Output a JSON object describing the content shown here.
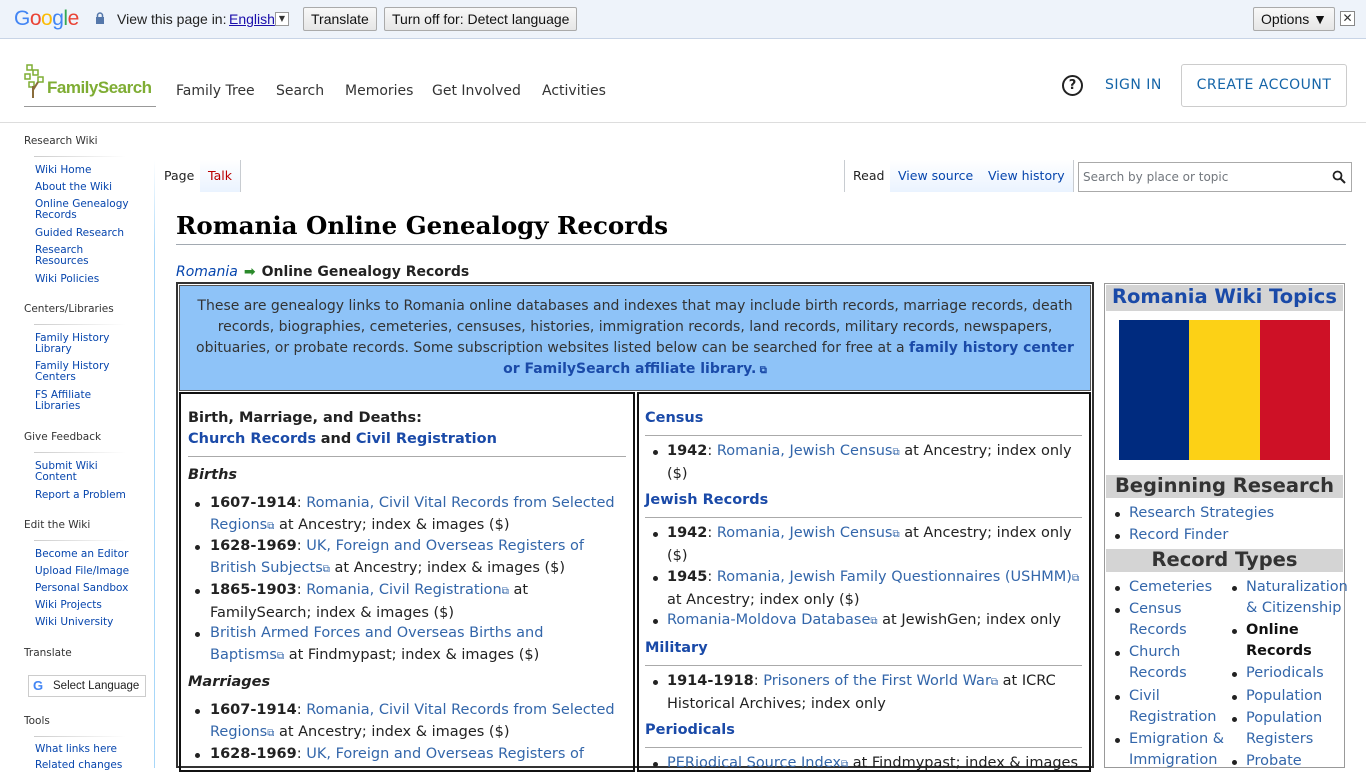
{
  "translate_bar": {
    "logo": "Google",
    "view_in": "View this page in:",
    "language": "English",
    "translate_btn": "Translate",
    "turn_off_btn": "Turn off for: Detect language",
    "options_btn": "Options ▼"
  },
  "header": {
    "logo_text": "FamilySearch",
    "nav": [
      "Family Tree",
      "Search",
      "Memories",
      "Get Involved",
      "Activities"
    ],
    "help": "?",
    "sign_in": "SIGN IN",
    "create_account": "CREATE ACCOUNT"
  },
  "sidebar": {
    "research_wiki": "Research Wiki",
    "wiki_links": [
      "Wiki Home",
      "About the Wiki",
      "Online Genealogy Records",
      "Guided Research",
      "Research Resources",
      "Wiki Policies"
    ],
    "centers": "Centers/Libraries",
    "center_links": [
      "Family History Library",
      "Family History Centers",
      "FS Affiliate Libraries"
    ],
    "feedback": "Give Feedback",
    "feedback_links": [
      "Submit Wiki Content",
      "Report a Problem"
    ],
    "edit": "Edit the Wiki",
    "edit_links": [
      "Become an Editor",
      "Upload File/Image",
      "Personal Sandbox",
      "Wiki Projects",
      "Wiki University"
    ],
    "translate": "Translate",
    "select_language": "Select Language",
    "tools": "Tools",
    "tool_links": [
      "What links here",
      "Related changes"
    ]
  },
  "tabs": {
    "page": "Page",
    "talk": "Talk",
    "read": "Read",
    "view_source": "View source",
    "view_history": "View history",
    "search_placeholder": "Search by place or topic"
  },
  "article": {
    "title": "Romania Online Genealogy Records",
    "crumb_parent": "Romania",
    "crumb_current": "Online Genealogy Records",
    "intro_text": "These are genealogy links to Romania online databases and indexes that may include birth records, marriage records, death records, biographies, cemeteries, censuses, histories, immigration records, land records, military records, newspapers, obituaries, or probate records. Some subscription websites listed below can be searched for free at a",
    "intro_link": "family history center or FamilySearch affiliate library."
  },
  "left_col": {
    "header": "Birth, Marriage, and Deaths:",
    "church": "Church Records",
    "and": "and",
    "civil": "Civil Registration",
    "births": "Births",
    "b1_years": "1607-1914",
    "b1_link": "Romania, Civil Vital Records from Selected Regions",
    "b1_rest": "at Ancestry; index & images ($)",
    "b2_years": "1628-1969",
    "b2_link": "UK, Foreign and Overseas Registers of British Subjects",
    "b2_rest": "at Ancestry; index & images ($)",
    "b3_years": "1865-1903",
    "b3_link": "Romania, Civil Registration",
    "b3_rest": "at FamilySearch; index & images ($)",
    "b4_link": "British Armed Forces and Overseas Births and Baptisms",
    "b4_rest": "at Findmypast; index & images ($)",
    "marriages": "Marriages",
    "m1_years": "1607-1914",
    "m1_link": "Romania, Civil Vital Records from Selected Regions",
    "m1_rest": "at Ancestry; index & images ($)",
    "m2_years": "1628-1969",
    "m2_link": "UK, Foreign and Overseas Registers of"
  },
  "right_col": {
    "census": "Census",
    "c1_years": "1942",
    "c1_link": "Romania, Jewish Census",
    "c1_rest": "at Ancestry; index only ($)",
    "jewish": "Jewish Records",
    "j1_years": "1942",
    "j1_link": "Romania, Jewish Census",
    "j1_rest": "at Ancestry; index only ($)",
    "j2_years": "1945",
    "j2_link": "Romania, Jewish Family Questionnaires (USHMM)",
    "j2_rest": "at Ancestry; index only ($)",
    "j3_link": "Romania-Moldova Database",
    "j3_rest": "at JewishGen; index only",
    "military": "Military",
    "mil1_years": "1914-1918",
    "mil1_link": "Prisoners of the First World War",
    "mil1_rest": "at ICRC Historical Archives; index only",
    "periodicals": "Periodicals",
    "p1_link": "PERiodical Source Index",
    "p1_rest": "at Findmypast; index & images"
  },
  "right_panel": {
    "title": "Romania Wiki Topics",
    "flag_colors": [
      "#002b7f",
      "#fcd116",
      "#ce1126"
    ],
    "beginning": "Beginning Research",
    "begin_links": [
      "Research Strategies",
      "Record Finder"
    ],
    "record_types": "Record Types",
    "types_left": [
      "Cemeteries",
      "Census Records",
      "Church Records",
      "Civil Registration",
      "Emigration & Immigration"
    ],
    "types_right": [
      "Naturalization & Citizenship",
      "Online Records",
      "Periodicals",
      "Population",
      "Population Registers",
      "Probate"
    ]
  }
}
